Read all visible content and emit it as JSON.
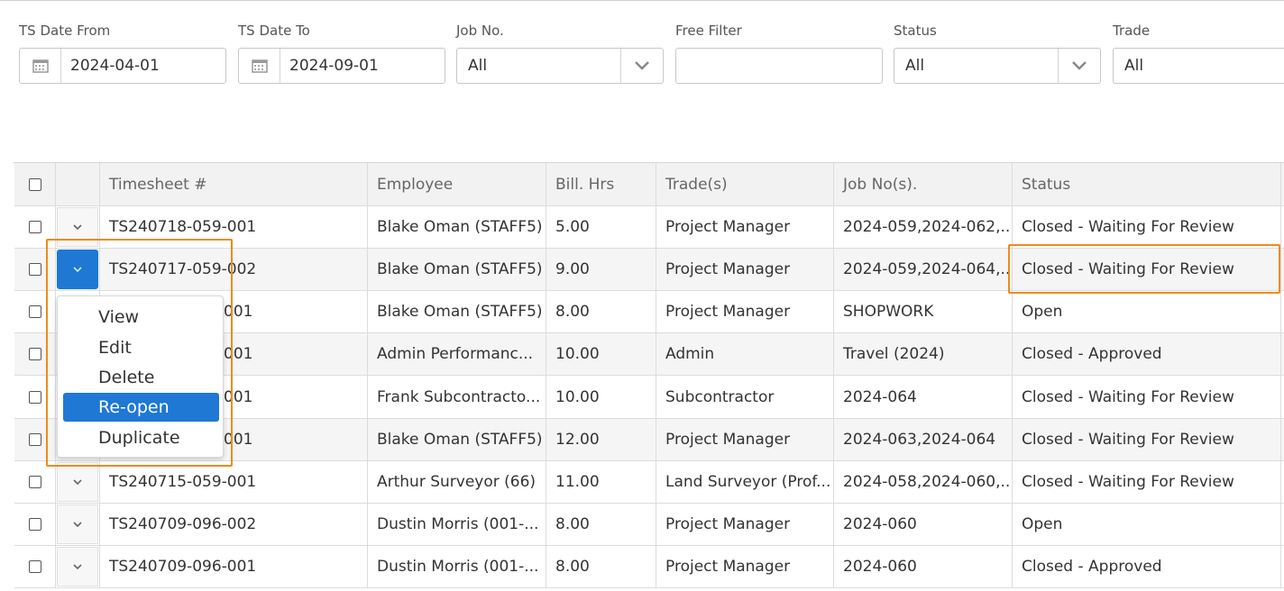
{
  "filters": {
    "date_from": {
      "label": "TS Date From",
      "value": "2024-04-01"
    },
    "date_to": {
      "label": "TS Date To",
      "value": "2024-09-01"
    },
    "job_no": {
      "label": "Job No.",
      "value": "All"
    },
    "free_filter": {
      "label": "Free Filter",
      "value": ""
    },
    "status": {
      "label": "Status",
      "value": "All"
    },
    "trade": {
      "label": "Trade",
      "value": "All"
    }
  },
  "table": {
    "columns": [
      "Timesheet #",
      "Employee",
      "Bill. Hrs",
      "Trade(s)",
      "Job No(s).",
      "Status"
    ],
    "rows": [
      {
        "ts": "TS240718-059-001",
        "employee": "Blake Oman (STAFF5)",
        "hrs": "5.00",
        "trade": "Project Manager",
        "job": "2024-059,2024-062,...",
        "status": "Closed - Waiting For Review"
      },
      {
        "ts": "TS240717-059-002",
        "employee": "Blake Oman (STAFF5)",
        "hrs": "9.00",
        "trade": "Project Manager",
        "job": "2024-059,2024-064,...",
        "status": "Closed - Waiting For Review"
      },
      {
        "ts": "001",
        "employee": "Blake Oman (STAFF5)",
        "hrs": "8.00",
        "trade": "Project Manager",
        "job": "SHOPWORK",
        "status": "Open"
      },
      {
        "ts": "001",
        "employee": "Admin Performanc...",
        "hrs": "10.00",
        "trade": "Admin",
        "job": "Travel (2024)",
        "status": "Closed - Approved"
      },
      {
        "ts": "001",
        "employee": "Frank Subcontracto...",
        "hrs": "10.00",
        "trade": "Subcontractor",
        "job": "2024-064",
        "status": "Closed - Waiting For Review"
      },
      {
        "ts": "001",
        "employee": "Blake Oman (STAFF5)",
        "hrs": "12.00",
        "trade": "Project Manager",
        "job": "2024-063,2024-064",
        "status": "Closed - Waiting For Review"
      },
      {
        "ts": "TS240715-059-001",
        "employee": "Arthur Surveyor (66)",
        "hrs": "11.00",
        "trade": "Land Surveyor (Prof...",
        "job": "2024-058,2024-060,...",
        "status": "Closed - Waiting For Review"
      },
      {
        "ts": "TS240709-096-002",
        "employee": "Dustin Morris (001-...",
        "hrs": "8.00",
        "trade": "Project Manager",
        "job": "2024-060",
        "status": "Open"
      },
      {
        "ts": "TS240709-096-001",
        "employee": "Dustin Morris (001-...",
        "hrs": "8.00",
        "trade": "Project Manager",
        "job": "2024-060",
        "status": "Closed - Approved"
      }
    ]
  },
  "row_menu": {
    "items": [
      "View",
      "Edit",
      "Delete",
      "Re-open",
      "Duplicate"
    ],
    "selected": "Re-open"
  },
  "icons": {
    "calendar": "calendar-icon",
    "chevron": "chevron-down-icon"
  },
  "colors": {
    "accent": "#1e78d4",
    "highlight": "#f08a1c"
  }
}
